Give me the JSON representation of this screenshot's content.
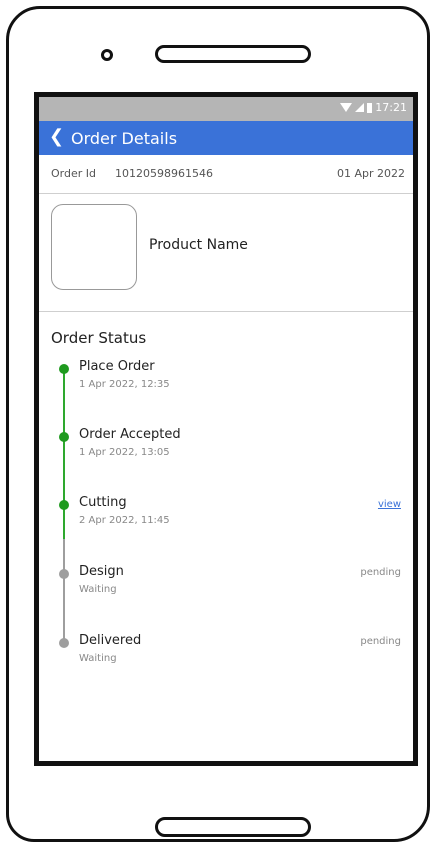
{
  "status_bar": {
    "time": "17:21"
  },
  "app_bar": {
    "title": "Order Details"
  },
  "order": {
    "id_label": "Order Id",
    "id_value": "10120598961546",
    "date": "01 Apr 2022"
  },
  "product": {
    "name": "Product Name"
  },
  "order_status": {
    "heading": "Order Status",
    "steps": [
      {
        "title": "Place Order",
        "time": "1 Apr 2022, 12:35",
        "state": "done"
      },
      {
        "title": "Order Accepted",
        "time": "1 Apr 2022, 13:05",
        "state": "done"
      },
      {
        "title": "Cutting",
        "time": "2 Apr 2022, 11:45",
        "state": "done",
        "action": "view"
      },
      {
        "title": "Design",
        "time": "Waiting",
        "state": "pending",
        "status": "pending"
      },
      {
        "title": "Delivered",
        "time": "Waiting",
        "state": "pending",
        "status": "pending"
      }
    ]
  },
  "colors": {
    "accent": "#3a72d8",
    "done": "#1f9a1f",
    "pending": "#9e9e9e",
    "status_bar": "#b5b5b5"
  },
  "icons": {
    "back": "chevron-left-icon",
    "wifi": "wifi-icon",
    "signal": "signal-icon",
    "battery": "battery-icon"
  }
}
